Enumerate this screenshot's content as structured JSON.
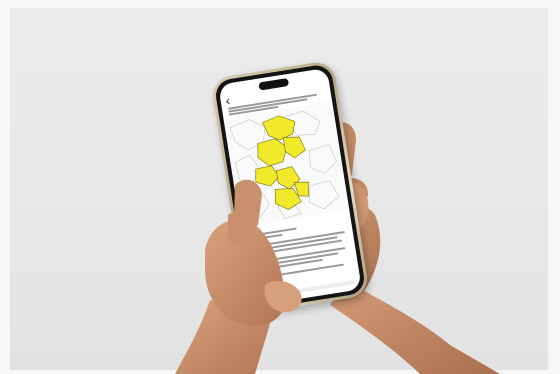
{
  "scene": {
    "description_colors": {
      "background": "#e9e9e9",
      "phone_frame": "#c9b998",
      "map_highlight": "#f2e92a",
      "skin": "#c98f6b"
    },
    "icons": [
      "back-arrow-icon",
      "map-icon",
      "avatar-icon"
    ]
  },
  "phone": {
    "status_time": "",
    "app_title": ""
  }
}
